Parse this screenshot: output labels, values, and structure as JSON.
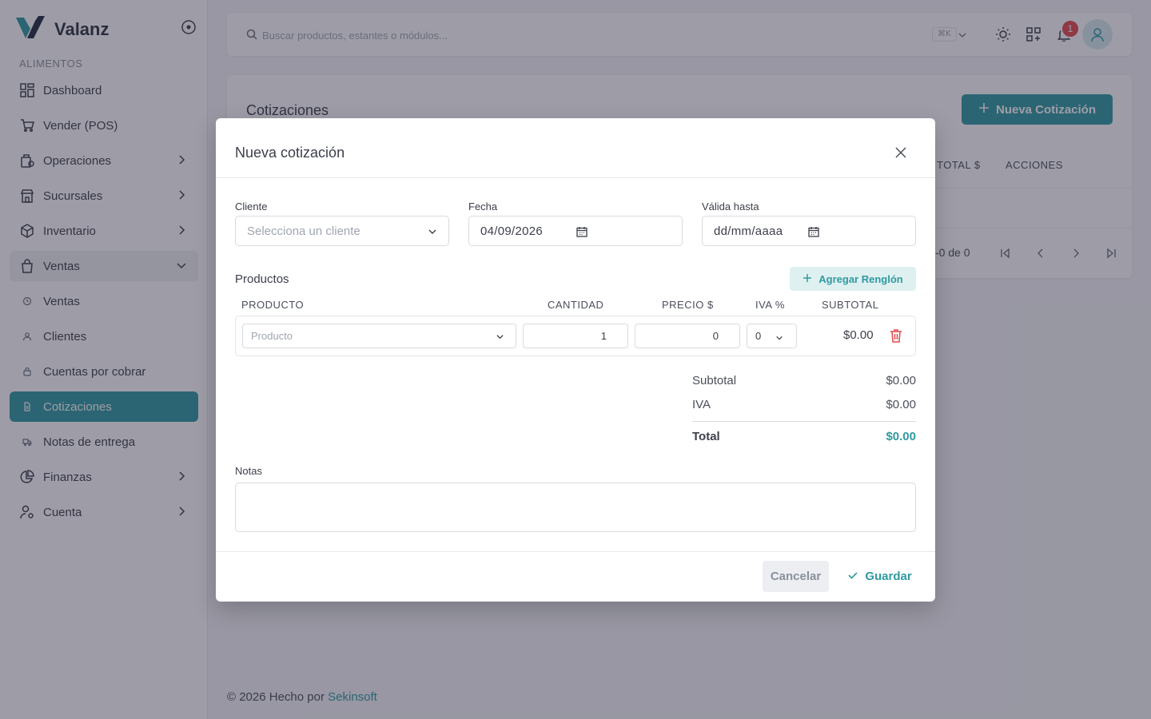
{
  "app": {
    "name": "Valanz"
  },
  "sidebar": {
    "section": "ALIMENTOS",
    "items": [
      {
        "label": "Dashboard",
        "icon": "dashboard-icon"
      },
      {
        "label": "Vender (POS)",
        "icon": "cart-icon"
      },
      {
        "label": "Operaciones",
        "icon": "operations-icon"
      },
      {
        "label": "Sucursales",
        "icon": "store-icon"
      },
      {
        "label": "Inventario",
        "icon": "box-icon"
      },
      {
        "label": "Ventas",
        "icon": "bag-icon"
      },
      {
        "label": "Ventas",
        "icon": "history-icon"
      },
      {
        "label": "Clientes",
        "icon": "users-icon"
      },
      {
        "label": "Cuentas por cobrar",
        "icon": "lock-icon"
      },
      {
        "label": "Cotizaciones",
        "icon": "document-icon"
      },
      {
        "label": "Notas de entrega",
        "icon": "truck-icon"
      },
      {
        "label": "Finanzas",
        "icon": "pie-chart-icon"
      },
      {
        "label": "Cuenta",
        "icon": "user-gear-icon"
      }
    ]
  },
  "topbar": {
    "search_placeholder": "Buscar productos, estantes o módulos...",
    "shortcut": "⌘K",
    "notification_count": "1"
  },
  "page": {
    "title": "Cotizaciones",
    "new_button": "Nueva Cotización",
    "columns": {
      "total": "TOTAL $",
      "actions": "ACCIONES"
    },
    "pagination": "-0 de 0"
  },
  "footer": {
    "prefix": "© 2026 Hecho por ",
    "link": "Sekinsoft"
  },
  "modal": {
    "title": "Nueva cotización",
    "client_label": "Cliente",
    "client_placeholder": "Selecciona un cliente",
    "date_label": "Fecha",
    "date_value": "04/09/2026",
    "valid_label": "Válida hasta",
    "valid_placeholder": "dd/mm/aaaa",
    "products_label": "Productos",
    "add_row": "Agregar Renglón",
    "columns": {
      "product": "PRODUCTO",
      "quantity": "CANTIDAD",
      "price": "PRECIO $",
      "iva": "IVA %",
      "subtotal": "SUBTOTAL"
    },
    "row": {
      "product_placeholder": "Producto",
      "quantity": "1",
      "price": "0",
      "iva": "0",
      "subtotal": "$0.00"
    },
    "summary": {
      "subtotal_label": "Subtotal",
      "subtotal_value": "$0.00",
      "iva_label": "IVA",
      "iva_value": "$0.00",
      "total_label": "Total",
      "total_value": "$0.00"
    },
    "notes_label": "Notas",
    "cancel": "Cancelar",
    "save": "Guardar"
  },
  "colors": {
    "accent": "#2f9aa0",
    "danger": "#e5484d"
  }
}
